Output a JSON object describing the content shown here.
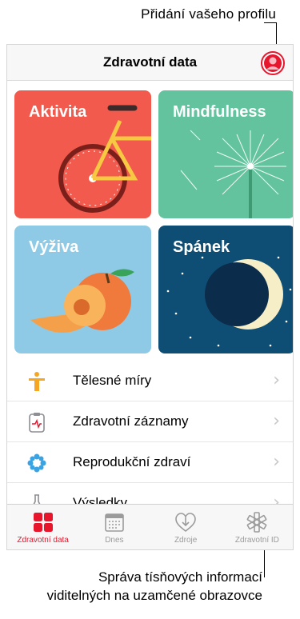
{
  "callouts": {
    "profile": "Přidání vašeho profilu",
    "medical_id": "Správa tísňových informací viditelných na uzamčené obrazovce"
  },
  "header": {
    "title": "Zdravotní data"
  },
  "tiles": [
    {
      "label": "Aktivita",
      "color": "#f15a4c"
    },
    {
      "label": "Mindfulness",
      "color": "#63c39e"
    },
    {
      "label": "Výživa",
      "color": "#8ecae6"
    },
    {
      "label": "Spánek",
      "color": "#0f4e74"
    }
  ],
  "list": [
    {
      "label": "Tělesné míry",
      "icon": "body-measurements-icon"
    },
    {
      "label": "Zdravotní záznamy",
      "icon": "health-records-icon"
    },
    {
      "label": "Reprodukční zdraví",
      "icon": "reproductive-health-icon"
    },
    {
      "label": "Výsledky",
      "icon": "results-icon"
    }
  ],
  "tabs": [
    {
      "label": "Zdravotní data",
      "active": true
    },
    {
      "label": "Dnes",
      "active": false
    },
    {
      "label": "Zdroje",
      "active": false
    },
    {
      "label": "Zdravotní ID",
      "active": false
    }
  ],
  "accent_color": "#e8162d"
}
